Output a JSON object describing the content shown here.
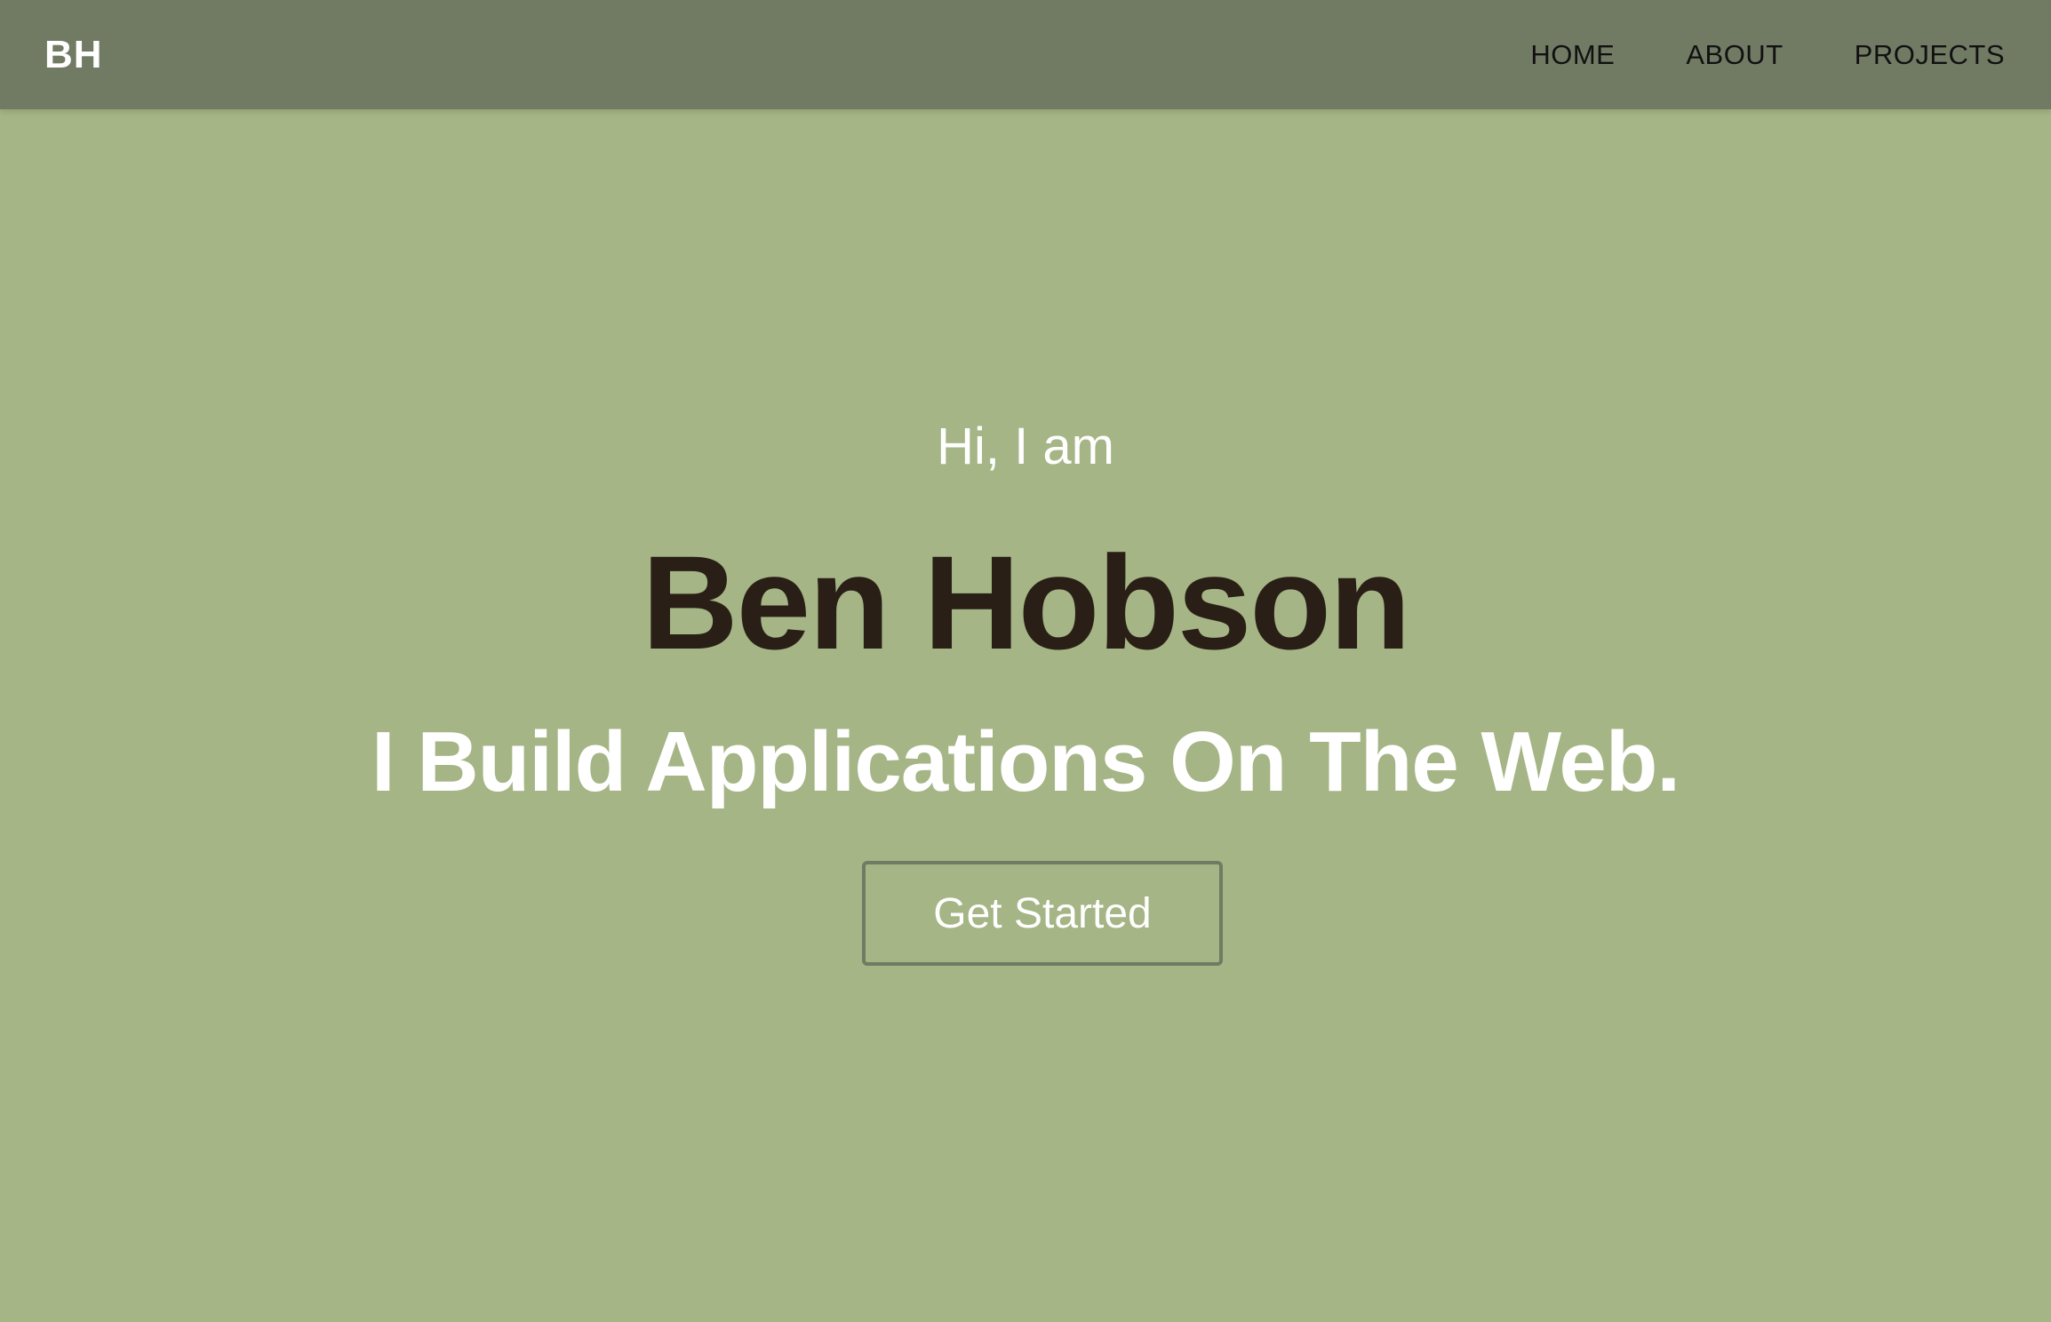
{
  "navbar": {
    "logo": "BH",
    "links": [
      "HOME",
      "ABOUT",
      "PROJECTS"
    ]
  },
  "hero": {
    "greeting": "Hi, I am",
    "name": "Ben Hobson",
    "tagline": "I Build Applications On The Web.",
    "cta_label": "Get Started"
  },
  "colors": {
    "background": "#a5b585",
    "navbar": "#717b64",
    "name_text": "#2a1f17",
    "light_text": "#ffffff",
    "button_border": "#717b64"
  }
}
